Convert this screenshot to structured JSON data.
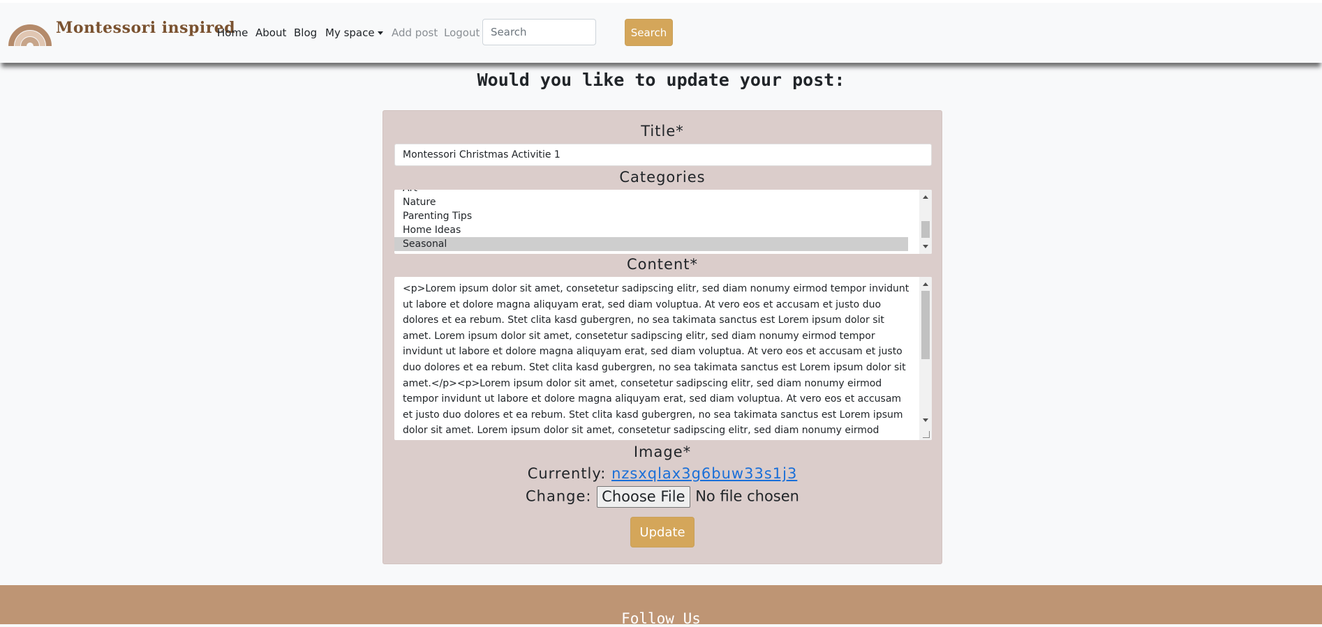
{
  "brand": {
    "name": "Montessori inspired"
  },
  "nav": {
    "home": "Home",
    "about": "About",
    "blog": "Blog",
    "my_space": "My space",
    "add_post": "Add post",
    "logout": "Logout"
  },
  "search": {
    "placeholder": "Search",
    "button": "Search"
  },
  "heading": "Would you like to update your post:",
  "form": {
    "title_label": "Title*",
    "title_value": "Montessori Christmas Activitie 1",
    "categories_label": "Categories",
    "categories": [
      "Art",
      "Nature",
      "Parenting Tips",
      "Home Ideas",
      "Seasonal"
    ],
    "selected_category": "Seasonal",
    "content_label": "Content*",
    "content_value": "<p>Lorem ipsum dolor sit amet, consetetur sadipscing elitr, sed diam nonumy eirmod tempor invidunt ut labore et dolore magna aliquyam erat, sed diam voluptua. At vero eos et accusam et justo duo dolores et ea rebum. Stet clita kasd gubergren, no sea takimata sanctus est Lorem ipsum dolor sit amet. Lorem ipsum dolor sit amet, consetetur sadipscing elitr, sed diam nonumy eirmod tempor invidunt ut labore et dolore magna aliquyam erat, sed diam voluptua. At vero eos et accusam et justo duo dolores et ea rebum. Stet clita kasd gubergren, no sea takimata sanctus est Lorem ipsum dolor sit amet.</p><p>Lorem ipsum dolor sit amet, consetetur sadipscing elitr, sed diam nonumy eirmod tempor invidunt ut labore et dolore magna aliquyam erat, sed diam voluptua. At vero eos et accusam et justo duo dolores et ea rebum. Stet clita kasd gubergren, no sea takimata sanctus est Lorem ipsum dolor sit amet. Lorem ipsum dolor sit amet, consetetur sadipscing elitr, sed diam nonumy eirmod tempor invidunt ut labore et dolore magna aliquyam erat, sed diam voluptua.",
    "image_label": "Image*",
    "currently_label": "Currently:",
    "current_image": "nzsxqlax3g6buw33s1j3",
    "change_label": "Change:",
    "choose_file": "Choose File",
    "no_file": "No file chosen",
    "update_button": "Update"
  },
  "footer": {
    "title": "Follow Us"
  },
  "colors": {
    "accent": "#d4a65a",
    "form_background": "#dbcdcb",
    "footer_background": "#be9574",
    "brand_text": "#7a5230",
    "link": "#1a6fd8"
  }
}
